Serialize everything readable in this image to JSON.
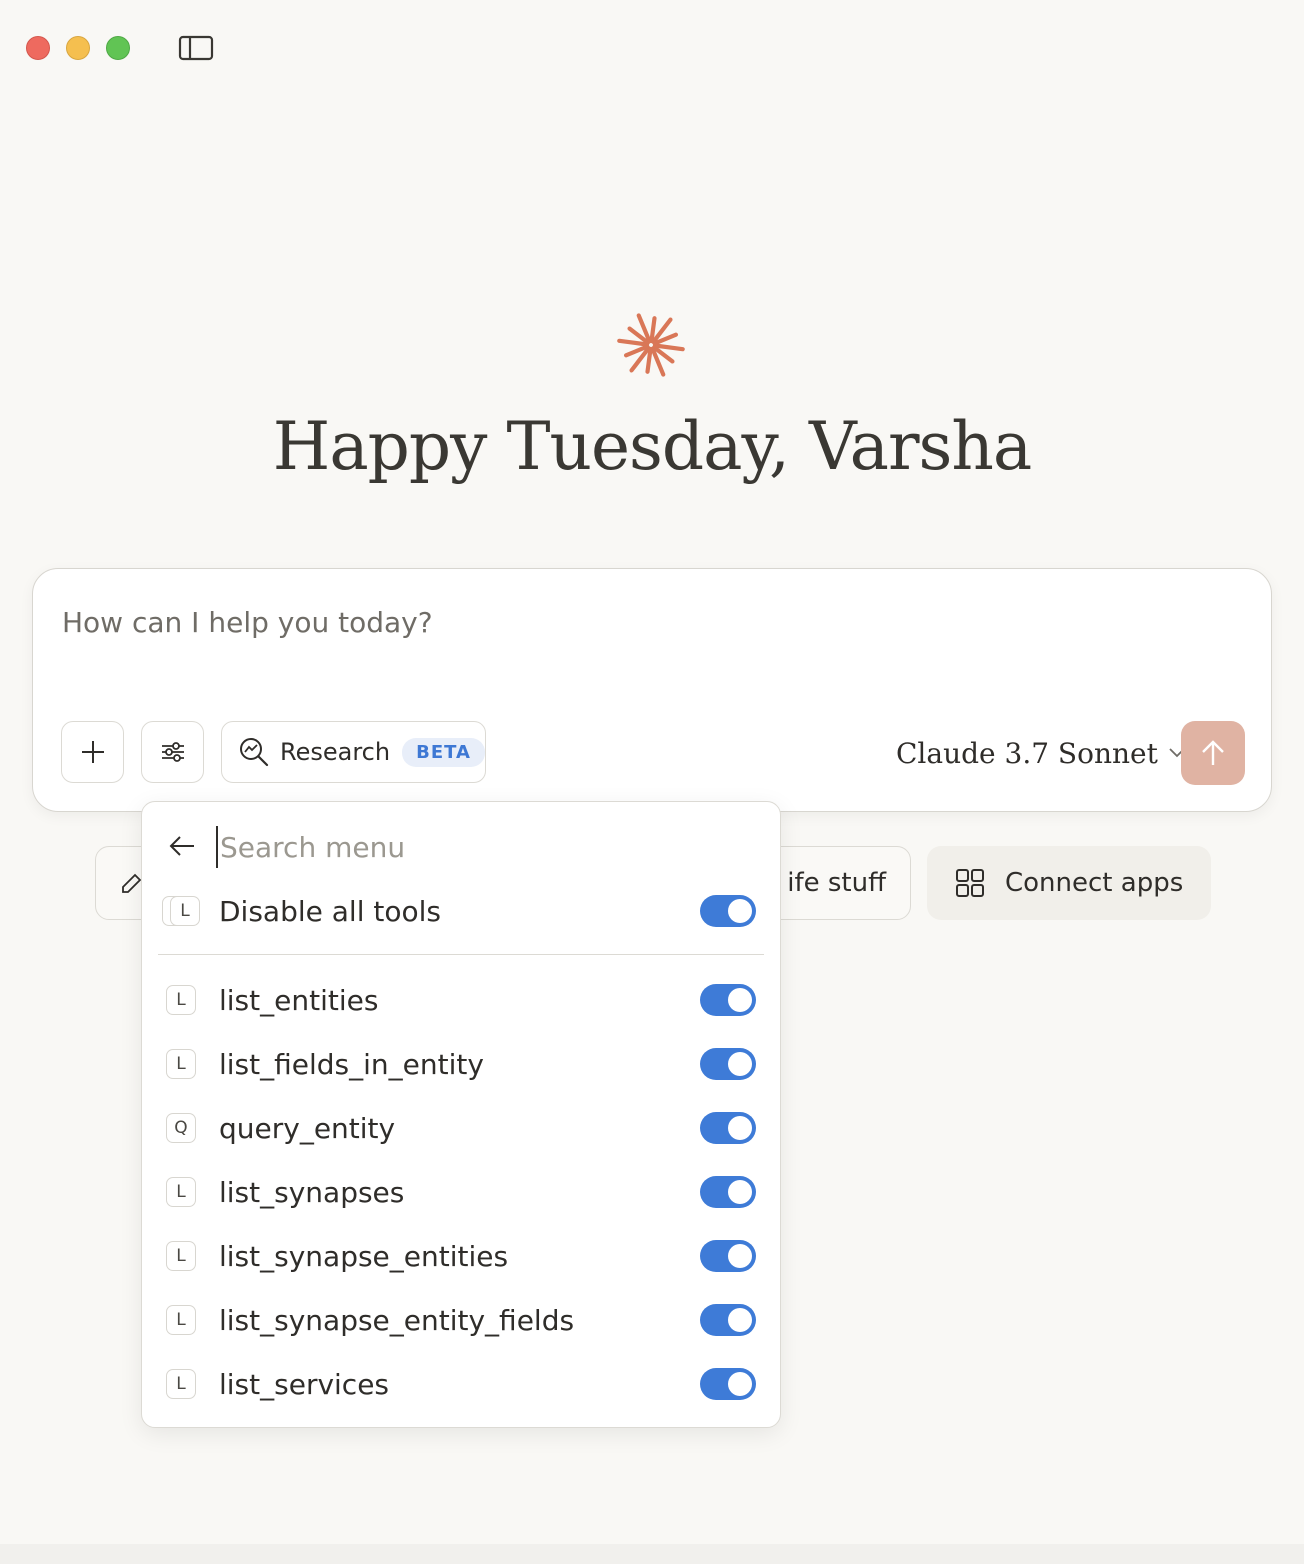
{
  "greeting": "Happy Tuesday, Varsha",
  "composer": {
    "placeholder": "How can I help you today?",
    "research_label": "Research",
    "beta_label": "BETA",
    "model_name": "Claude 3.7 Sonnet"
  },
  "chips": {
    "left_partial": "",
    "life_partial": "ife stuff",
    "connect_apps": "Connect apps"
  },
  "menu": {
    "search_placeholder": "Search menu",
    "disable_all": {
      "label": "Disable all tools",
      "icon_letter": "L",
      "enabled": true
    },
    "tools": [
      {
        "letter": "L",
        "label": "list_entities",
        "enabled": true
      },
      {
        "letter": "L",
        "label": "list_fields_in_entity",
        "enabled": true
      },
      {
        "letter": "Q",
        "label": "query_entity",
        "enabled": true
      },
      {
        "letter": "L",
        "label": "list_synapses",
        "enabled": true
      },
      {
        "letter": "L",
        "label": "list_synapse_entities",
        "enabled": true
      },
      {
        "letter": "L",
        "label": "list_synapse_entity_fields",
        "enabled": true
      },
      {
        "letter": "L",
        "label": "list_services",
        "enabled": true
      }
    ]
  },
  "colors": {
    "accent_blue": "#3e7bd7",
    "spark_orange": "#d97757",
    "send_button": "#e0b3a3",
    "background": "#f9f8f5"
  },
  "icons": [
    "sidebar-toggle-icon",
    "spark-icon",
    "plus-icon",
    "sliders-icon",
    "research-icon",
    "chevron-down-icon",
    "arrow-up-icon",
    "back-arrow-icon",
    "grid-icon",
    "pencil-icon"
  ]
}
